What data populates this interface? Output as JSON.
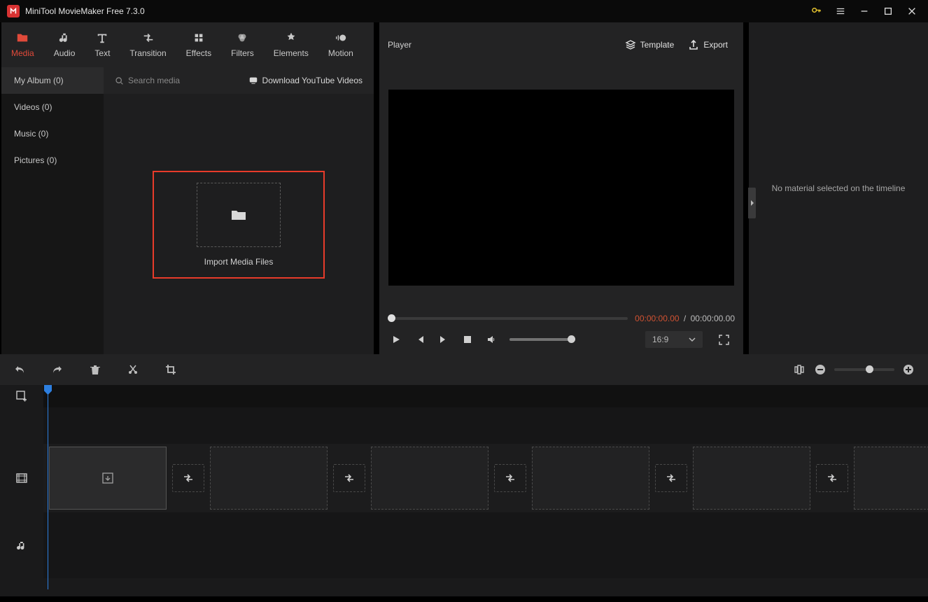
{
  "app": {
    "title": "MiniTool MovieMaker Free 7.3.0"
  },
  "tabs": {
    "media": {
      "label": "Media"
    },
    "audio": {
      "label": "Audio"
    },
    "text": {
      "label": "Text"
    },
    "transition": {
      "label": "Transition"
    },
    "effects": {
      "label": "Effects"
    },
    "filters": {
      "label": "Filters"
    },
    "elements": {
      "label": "Elements"
    },
    "motion": {
      "label": "Motion"
    }
  },
  "sidebar": {
    "items": [
      {
        "label": "My Album (0)"
      },
      {
        "label": "Videos (0)"
      },
      {
        "label": "Music (0)"
      },
      {
        "label": "Pictures (0)"
      }
    ]
  },
  "browser": {
    "search_placeholder": "Search media",
    "download_label": "Download YouTube Videos",
    "import_label": "Import Media Files"
  },
  "player": {
    "title": "Player",
    "template_label": "Template",
    "export_label": "Export",
    "time_current": "00:00:00.00",
    "time_separator": "/",
    "time_duration": "00:00:00.00",
    "aspect_ratio": "16:9"
  },
  "properties": {
    "empty_label": "No material selected on the timeline"
  }
}
